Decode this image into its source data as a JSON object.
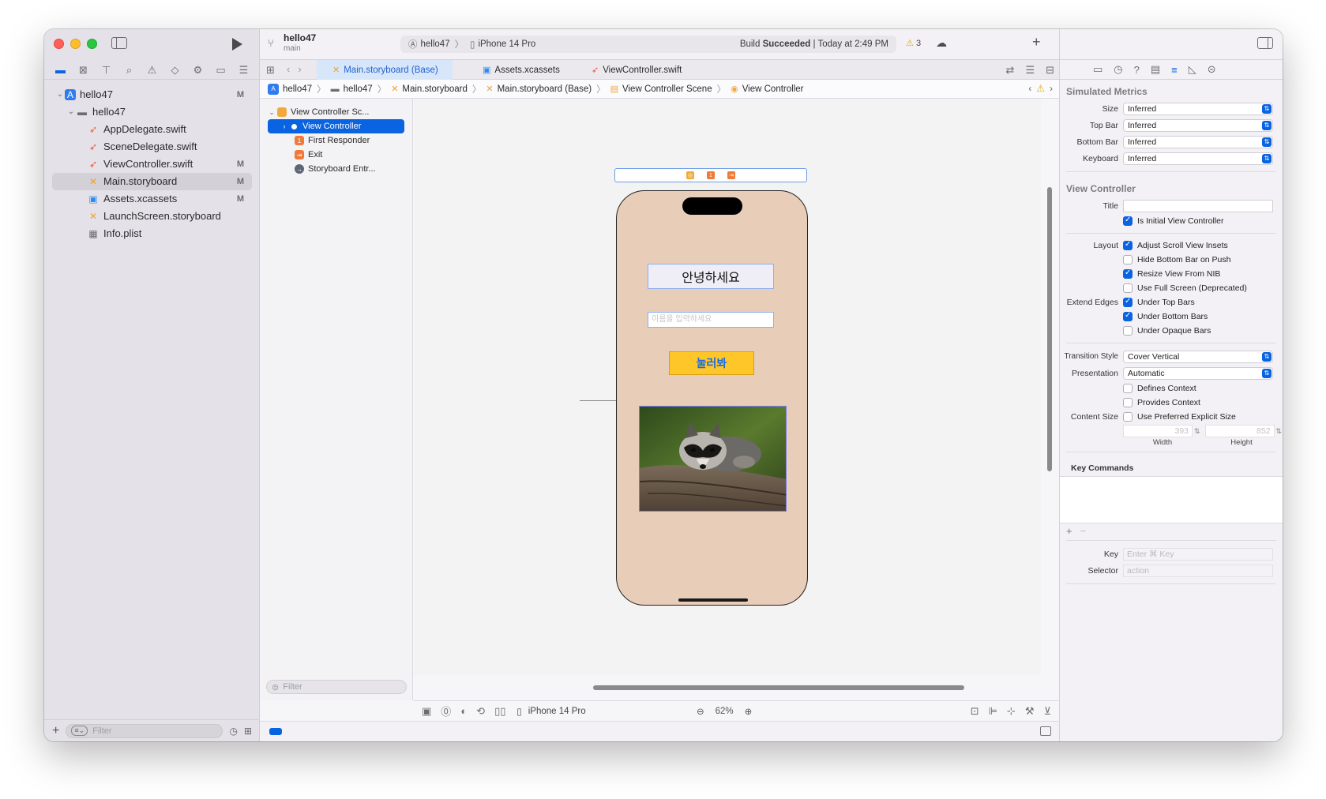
{
  "navigator": {
    "tree": [
      {
        "label": "hello47",
        "badge": "M",
        "icon": "project-icon",
        "indent": 0,
        "chevron": "⌄"
      },
      {
        "label": "hello47",
        "badge": "",
        "icon": "folder-icon",
        "indent": 1,
        "chevron": "⌄"
      },
      {
        "label": "AppDelegate.swift",
        "badge": "",
        "icon": "swift-file-icon",
        "indent": 2
      },
      {
        "label": "SceneDelegate.swift",
        "badge": "",
        "icon": "swift-file-icon",
        "indent": 2
      },
      {
        "label": "ViewController.swift",
        "badge": "M",
        "icon": "swift-file-icon",
        "indent": 2
      },
      {
        "label": "Main.storyboard",
        "badge": "M",
        "icon": "storyboard-file-icon",
        "indent": 2,
        "selected": true
      },
      {
        "label": "Assets.xcassets",
        "badge": "M",
        "icon": "assets-icon",
        "indent": 2
      },
      {
        "label": "LaunchScreen.storyboard",
        "badge": "",
        "icon": "storyboard-file-icon",
        "indent": 2
      },
      {
        "label": "Info.plist",
        "badge": "",
        "icon": "plist-icon",
        "indent": 2
      }
    ],
    "filter_placeholder": "Filter"
  },
  "toolbar": {
    "project": "hello47",
    "branch": "main",
    "scheme": "hello47",
    "device": "iPhone 14 Pro",
    "status_prefix": "Build ",
    "status_bold": "Succeeded",
    "status_suffix": " | Today at 2:49 PM",
    "warnings": "3"
  },
  "tabs": [
    {
      "label": "Main.storyboard (Base)",
      "active": true
    },
    {
      "label": "Assets.xcassets",
      "active": false
    },
    {
      "label": "ViewController.swift",
      "active": false
    }
  ],
  "jumpbar": [
    "hello47",
    "hello47",
    "Main.storyboard",
    "Main.storyboard (Base)",
    "View Controller Scene",
    "View Controller"
  ],
  "outline": {
    "scene": "View Controller Sc...",
    "items": [
      "View Controller",
      "First Responder",
      "Exit",
      "Storyboard Entr..."
    ],
    "filter_placeholder": "Filter"
  },
  "canvas": {
    "greeting": "안녕하세요",
    "input_placeholder": "이름을 입력하세요",
    "button": "눌러봐",
    "phone_bg": "#e8cdb9",
    "button_bg": "#ffc629"
  },
  "bottombar": {
    "device": "iPhone 14 Pro",
    "zoom": "62%"
  },
  "inspector": {
    "sim_title": "Simulated Metrics",
    "metrics": [
      {
        "label": "Size",
        "value": "Inferred"
      },
      {
        "label": "Top Bar",
        "value": "Inferred"
      },
      {
        "label": "Bottom Bar",
        "value": "Inferred"
      },
      {
        "label": "Keyboard",
        "value": "Inferred"
      }
    ],
    "vc_title": "View Controller",
    "title_label": "Title",
    "initial_vc": "Is Initial View Controller",
    "layout_label": "Layout",
    "layout_opts": [
      {
        "label": "Adjust Scroll View Insets",
        "on": true
      },
      {
        "label": "Hide Bottom Bar on Push",
        "on": false
      },
      {
        "label": "Resize View From NIB",
        "on": true
      },
      {
        "label": "Use Full Screen (Deprecated)",
        "on": false
      }
    ],
    "edges_label": "Extend Edges",
    "edges_opts": [
      {
        "label": "Under Top Bars",
        "on": true
      },
      {
        "label": "Under Bottom Bars",
        "on": true
      },
      {
        "label": "Under Opaque Bars",
        "on": false
      }
    ],
    "transition_label": "Transition Style",
    "transition_value": "Cover Vertical",
    "presentation_label": "Presentation",
    "presentation_value": "Automatic",
    "defines_context": "Defines Context",
    "provides_context": "Provides Context",
    "content_size_label": "Content Size",
    "preferred_size": "Use Preferred Explicit Size",
    "width_value": "393",
    "height_value": "852",
    "width_label": "Width",
    "height_label": "Height",
    "key_commands": "Key Commands",
    "key_label": "Key",
    "key_placeholder": "Enter ⌘ Key",
    "selector_label": "Selector",
    "selector_placeholder": "action"
  }
}
